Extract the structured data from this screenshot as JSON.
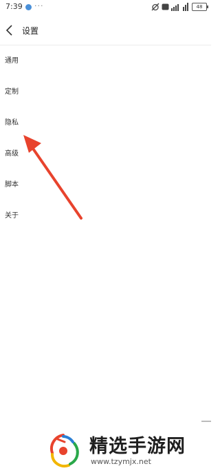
{
  "status_bar": {
    "time": "7:39",
    "battery": "48"
  },
  "header": {
    "title": "设置"
  },
  "menu": {
    "items": [
      {
        "label": "通用"
      },
      {
        "label": "定制"
      },
      {
        "label": "隐私"
      },
      {
        "label": "高级"
      },
      {
        "label": "脚本"
      },
      {
        "label": "关于"
      }
    ]
  },
  "annotation": {
    "arrow_color": "#e8432d"
  },
  "watermark": {
    "title": "精选手游网",
    "url": "www.tzymjx.net"
  }
}
